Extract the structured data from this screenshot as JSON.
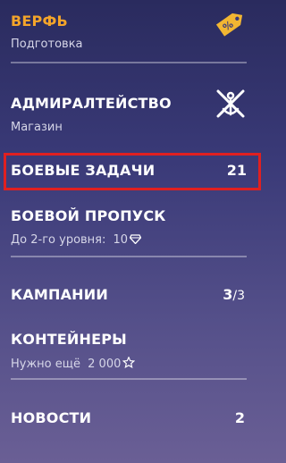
{
  "menu": {
    "shipyard": {
      "title": "ВЕРФЬ",
      "sub": "Подготовка",
      "title_color": "#f4a52a",
      "icon": "percent-tag-icon"
    },
    "admiralty": {
      "title": "АДМИРАЛТЕЙСТВО",
      "sub": "Магазин",
      "icon": "anchor-crossed-icon"
    },
    "combat_missions": {
      "title": "БОЕВЫЕ ЗАДАЧИ",
      "count": "21"
    },
    "battle_pass": {
      "title": "БОЕВОЙ ПРОПУСК",
      "sub_prefix": "До 2-го уровня:",
      "sub_value": "10",
      "icon": "diamond-icon"
    },
    "campaigns": {
      "title": "КАМПАНИИ",
      "count_main": "3",
      "count_total": "/3"
    },
    "containers": {
      "title": "КОНТЕЙНЕРЫ",
      "sub_prefix": "Нужно ещё",
      "sub_value": "2 000",
      "icon": "star-icon"
    },
    "news": {
      "title": "НОВОСТИ",
      "count": "2"
    }
  },
  "colors": {
    "accent": "#f4a52a",
    "highlight": "#e02020"
  }
}
